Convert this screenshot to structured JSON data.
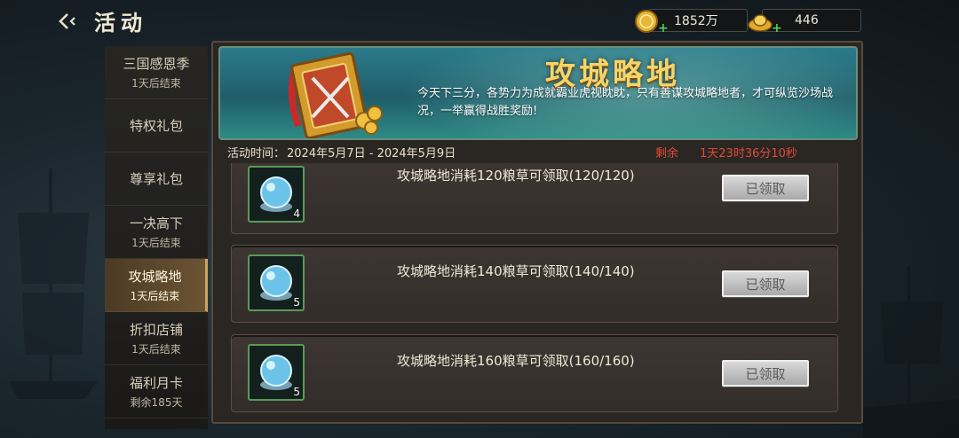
{
  "header": {
    "title": "活动",
    "gold_value": "1852万",
    "ingot_value": "446"
  },
  "sidebar": {
    "items": [
      {
        "label": "三国感恩季",
        "sub": "1天后结束"
      },
      {
        "label": "特权礼包",
        "sub": ""
      },
      {
        "label": "尊享礼包",
        "sub": ""
      },
      {
        "label": "一决高下",
        "sub": "1天后结束"
      },
      {
        "label": "攻城略地",
        "sub": "1天后结束",
        "active": true
      },
      {
        "label": "折扣店铺",
        "sub": "1天后结束"
      },
      {
        "label": "福利月卡",
        "sub": "剩余185天"
      }
    ]
  },
  "banner": {
    "title": "攻城略地",
    "description": "今天下三分，各势力为成就霸业虎视眈眈，只有善谋攻城略地者，才可纵览沙场战况，一举赢得战胜奖励!"
  },
  "event": {
    "time_label": "活动时间：",
    "time_value": "2024年5月7日 - 2024年5月9日",
    "remain_label": "剩余",
    "remain_value": "1天23时36分10秒"
  },
  "tasks": [
    {
      "text": "攻城略地消耗120粮草可领取(120/120)",
      "item_count": "4",
      "button": "已领取"
    },
    {
      "text": "攻城略地消耗140粮草可领取(140/140)",
      "item_count": "5",
      "button": "已领取"
    },
    {
      "text": "攻城略地消耗160粮草可领取(160/160)",
      "item_count": "5",
      "button": "已领取"
    }
  ],
  "colors": {
    "accent_gold": "#f6d468",
    "remain_red": "#e04a3a",
    "item_border_green": "#5a9a5a"
  },
  "icons": {
    "back": "back-arrow-icon",
    "gold": "gold-coin-icon",
    "ingot": "gold-ingot-icon",
    "reward": "crystal-orb-icon"
  }
}
